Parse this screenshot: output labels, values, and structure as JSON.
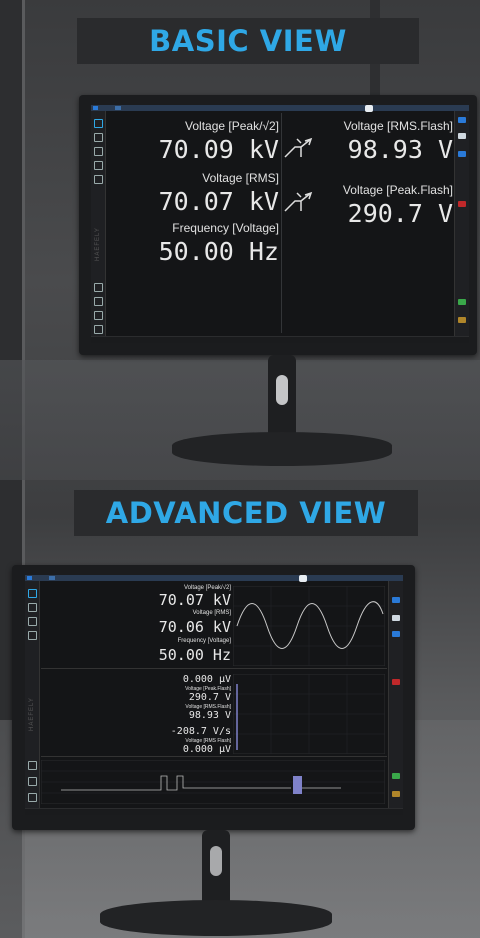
{
  "basic": {
    "title": "BASIC VIEW",
    "brand": "HAEFELY",
    "left_labels": [
      "Voltage [Peak/√2]",
      "Voltage [RMS]",
      "Frequency [Voltage]"
    ],
    "left_values": [
      "70.09 kV",
      "70.07 kV",
      "50.00  Hz"
    ],
    "right_labels": [
      "Voltage [RMS.Flash]",
      "Voltage [Peak.Flash]"
    ],
    "right_values": [
      "98.93  V",
      "290.7  V"
    ]
  },
  "advanced": {
    "title": "ADVANCED VIEW",
    "brand": "HAEFELY",
    "top_labels": [
      "Voltage [Peak/√2]",
      "Voltage [RMS]",
      "Frequency [Voltage]"
    ],
    "top_values": [
      "70.07 kV",
      "70.06 kV",
      "50.00  Hz"
    ],
    "mid_labels": [
      "Voltage [Peak.Flash]",
      "Voltage [RMS.Flash]",
      "Voltage [RMS Flash]"
    ],
    "mid_values": [
      "0.000 μV",
      "290.7  V",
      "98.93  V",
      "-208.7  V/s",
      "0.000 μV"
    ]
  },
  "colors": {
    "accent": "#2fa8e6",
    "screen_bg": "#141517",
    "wave": "#c8c8c8",
    "pulse": "#7f82c9"
  }
}
